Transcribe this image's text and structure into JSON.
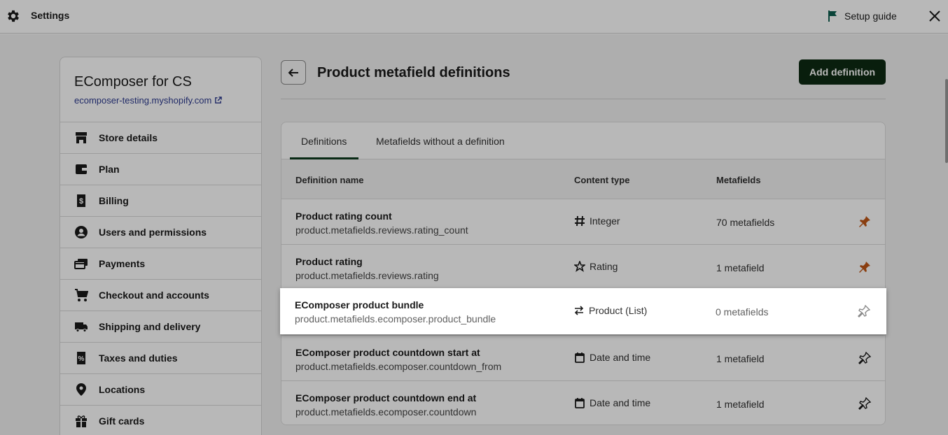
{
  "topbar": {
    "title": "Settings",
    "setup_guide": "Setup guide"
  },
  "sidebar": {
    "store_name": "EComposer for CS",
    "store_url": "ecomposer-testing.myshopify.com",
    "items": [
      {
        "label": "Store details",
        "icon": "store-icon"
      },
      {
        "label": "Plan",
        "icon": "wallet-icon"
      },
      {
        "label": "Billing",
        "icon": "billing-icon"
      },
      {
        "label": "Users and permissions",
        "icon": "user-icon"
      },
      {
        "label": "Payments",
        "icon": "payments-icon"
      },
      {
        "label": "Checkout and accounts",
        "icon": "cart-icon"
      },
      {
        "label": "Shipping and delivery",
        "icon": "truck-icon"
      },
      {
        "label": "Taxes and duties",
        "icon": "tax-icon"
      },
      {
        "label": "Locations",
        "icon": "location-icon"
      },
      {
        "label": "Gift cards",
        "icon": "gift-icon"
      }
    ]
  },
  "page": {
    "title": "Product metafield definitions",
    "add_button": "Add definition"
  },
  "tabs": [
    {
      "label": "Definitions",
      "active": true
    },
    {
      "label": "Metafields without a definition",
      "active": false
    }
  ],
  "table": {
    "headers": [
      "Definition name",
      "Content type",
      "Metafields"
    ],
    "rows": [
      {
        "name": "Product rating count",
        "key": "product.metafields.reviews.rating_count",
        "type": "Integer",
        "type_icon": "hash-icon",
        "count": "70 metafields",
        "pinned": true
      },
      {
        "name": "Product rating",
        "key": "product.metafields.reviews.rating",
        "type": "Rating",
        "type_icon": "star-icon",
        "count": "1 metafield",
        "pinned": true
      },
      {
        "name": "EComposer product bundle",
        "key": "product.metafields.ecomposer.product_bundle",
        "type": "Product (List)",
        "type_icon": "arrows-icon",
        "count": "0 metafields",
        "pinned": false
      },
      {
        "name": "EComposer product countdown start at",
        "key": "product.metafields.ecomposer.countdown_from",
        "type": "Date and time",
        "type_icon": "calendar-icon",
        "count": "1 metafield",
        "pinned": false
      },
      {
        "name": "EComposer product countdown end at",
        "key": "product.metafields.ecomposer.countdown",
        "type": "Date and time",
        "type_icon": "calendar-icon",
        "count": "1 metafield",
        "pinned": false
      }
    ]
  },
  "colors": {
    "primary_button": "#0d2a12",
    "pin_active": "#c05717",
    "link": "#2c3a8f"
  }
}
